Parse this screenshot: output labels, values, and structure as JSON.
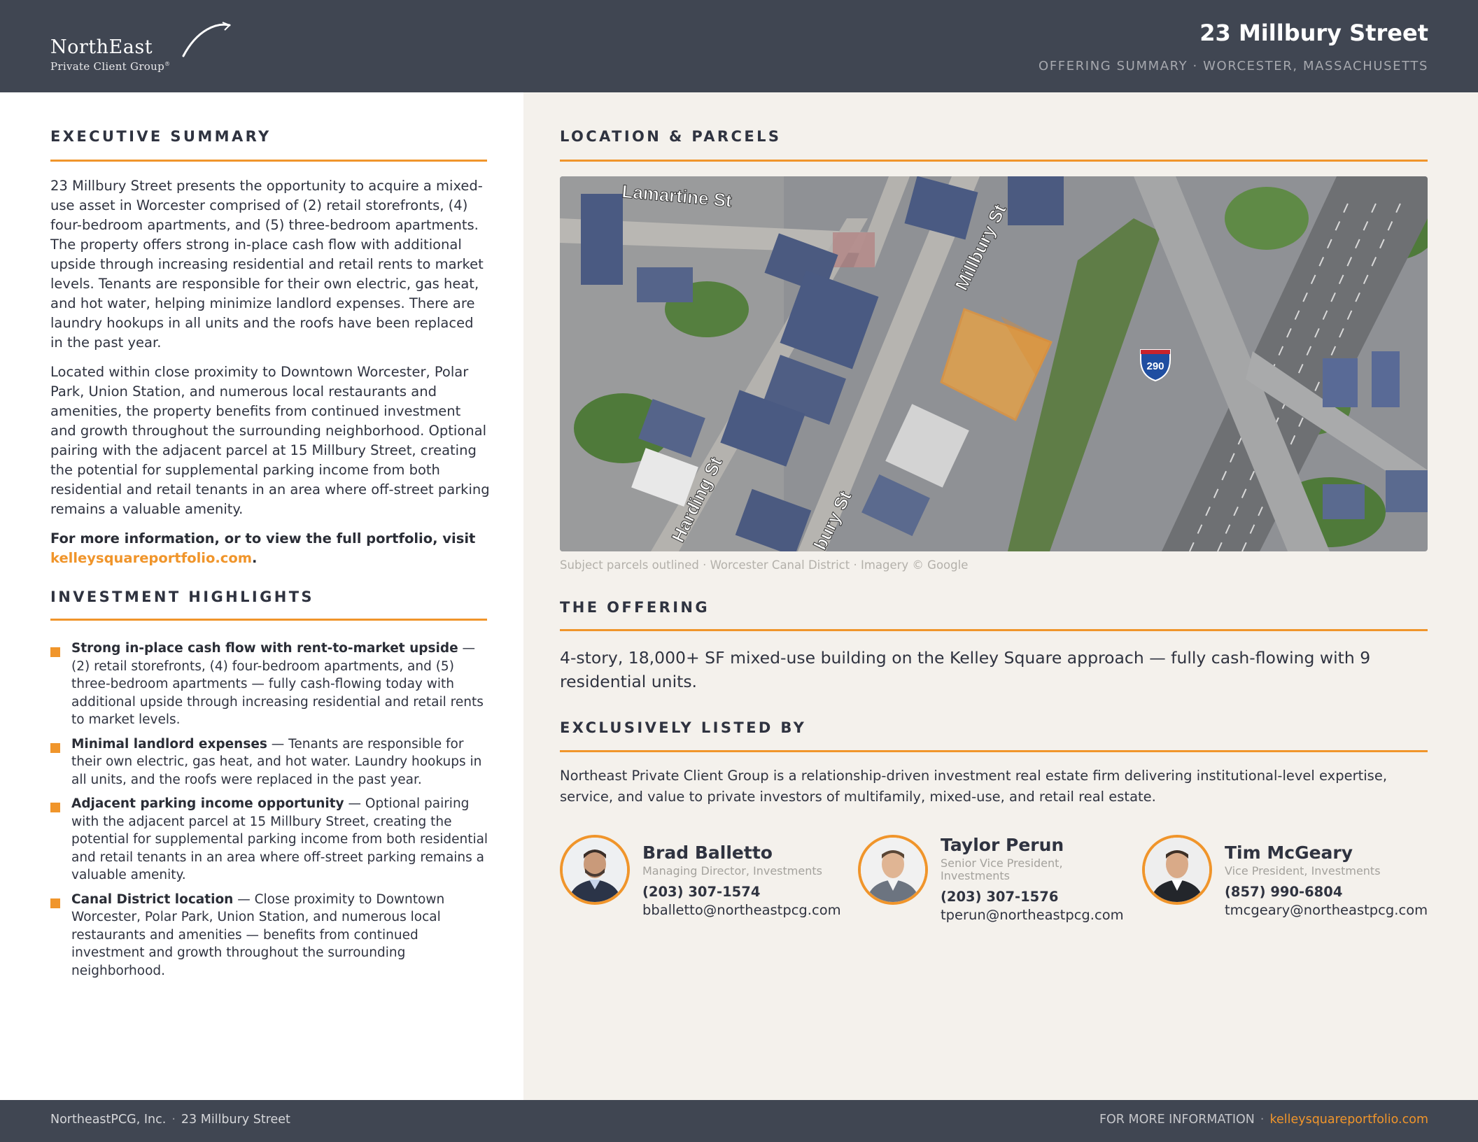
{
  "header": {
    "logo_name": "NorthEast",
    "logo_sub": "Private Client Group",
    "logo_tm": "®",
    "title": "23 Millbury Street",
    "subtitle": "OFFERING SUMMARY · WORCESTER, MASSACHUSETTS"
  },
  "executive_summary": {
    "title": "EXECUTIVE SUMMARY",
    "paragraphs": [
      "23 Millbury Street presents the opportunity to acquire a mixed-use asset in Worcester comprised of (2) retail storefronts, (4) four-bedroom apartments, and (5) three-bedroom apartments. The property offers strong in-place cash flow with additional upside through increasing residential and retail rents to market levels. Tenants are responsible for their own electric, gas heat, and hot water, helping minimize landlord expenses. There are laundry hookups in all units and the roofs have been replaced in the past year.",
      "Located within close proximity to Downtown Worcester, Polar Park, Union Station, and numerous local restaurants and amenities, the property benefits from continued investment and growth throughout the surrounding neighborhood. Optional pairing with the adjacent parcel at 15 Millbury Street, creating the potential for supplemental parking income from both residential and retail tenants in an area where off-street parking remains a valuable amenity."
    ],
    "cta_text": "For more information, or to view the full portfolio, visit",
    "cta_link": "kelleysquareportfolio.com",
    "cta_end": "."
  },
  "investment_highlights": {
    "title": "INVESTMENT HIGHLIGHTS",
    "items": [
      {
        "heading": "Strong in-place cash flow with rent-to-market upside",
        "text": " — (2) retail storefronts, (4) four-bedroom apartments, and (5) three-bedroom apartments — fully cash-flowing today with additional upside through increasing residential and retail rents to market levels."
      },
      {
        "heading": "Minimal landlord expenses",
        "text": " — Tenants are responsible for their own electric, gas heat, and hot water. Laundry hookups in all units, and the roofs were replaced in the past year."
      },
      {
        "heading": "Adjacent parking income opportunity",
        "text": " — Optional pairing with the adjacent parcel at 15 Millbury Street, creating the potential for supplemental parking income from both residential and retail tenants in an area where off-street parking remains a valuable amenity."
      },
      {
        "heading": "Canal District location",
        "text": " — Close proximity to Downtown Worcester, Polar Park, Union Station, and numerous local restaurants and amenities — benefits from continued investment and growth throughout the surrounding neighborhood."
      }
    ]
  },
  "location": {
    "title": "LOCATION & PARCELS",
    "map_labels": {
      "street_1": "Lamartine St",
      "street_2": "Millbury St",
      "street_3": "Harding St",
      "street_4": "bury St",
      "highway_shield": "290"
    },
    "caption": "Subject parcels outlined · Worcester Canal District · Imagery © Google"
  },
  "offering": {
    "title": "THE OFFERING",
    "text": "4-story, 18,000+ SF mixed-use building on the Kelley Square approach — fully cash-flowing with 9 residential units."
  },
  "listed_by": {
    "title": "EXCLUSIVELY LISTED BY",
    "firm_text": "Northeast Private Client Group is a relationship-driven investment real estate firm delivering institutional-level expertise, service, and value to private investors of multifamily, mixed-use, and retail real estate.",
    "agents": [
      {
        "name": "Brad Balletto",
        "title": "Managing Director, Investments",
        "phone": "(203) 307-1574",
        "email": "bballetto@northeastpcg.com"
      },
      {
        "name": "Taylor Perun",
        "title": "Senior Vice President, Investments",
        "phone": "(203) 307-1576",
        "email": "tperun@northeastpcg.com"
      },
      {
        "name": "Tim McGeary",
        "title": "Vice President, Investments",
        "phone": "(857) 990-6804",
        "email": "tmcgeary@northeastpcg.com"
      }
    ]
  },
  "footer": {
    "company": "NortheastPCG, Inc.",
    "separator": "·",
    "address": "23 Millbury Street",
    "more_info": "FOR MORE INFORMATION",
    "url": "kelleysquareportfolio.com"
  },
  "colors": {
    "accent": "#f0952b",
    "header_bg": "#404652",
    "right_panel_bg": "#f4f1ec"
  }
}
